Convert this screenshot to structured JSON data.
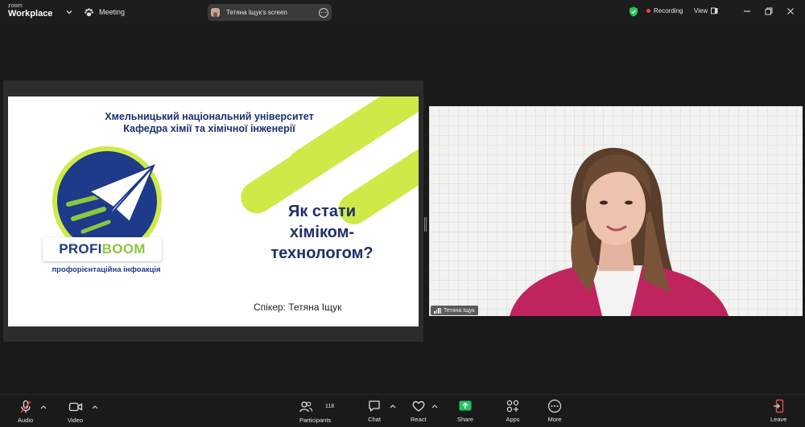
{
  "topbar": {
    "logo_line1": "zoom",
    "logo_line2": "Workplace",
    "meeting_label": "Meeting",
    "screen_title": "Тетяна Іщук's screen",
    "more_glyph": "⋯",
    "recording_label": "Recording",
    "view_label": "View"
  },
  "slide": {
    "university_line1": "Хмельницький національний університет",
    "university_line2": "Кафедра хімії та хімічної інженерії",
    "title_line1": "Як стати",
    "title_line2": "хіміком-",
    "title_line3": "технологом?",
    "speaker": "Спікер: Тетяна Іщук",
    "brand_part1": "PROFI",
    "brand_part2": "BOOM",
    "brand_sub": "профорієнтаційна інфоакція",
    "colors": {
      "navy": "#1e2f6b",
      "lime": "#cdea48",
      "green": "#8cc63f"
    }
  },
  "video": {
    "participant_name": "Тетяна Іщук"
  },
  "toolbar": {
    "audio_label": "Audio",
    "video_label": "Video",
    "participants_label": "Participants",
    "participants_count": "118",
    "chat_label": "Chat",
    "react_label": "React",
    "share_label": "Share",
    "apps_label": "Apps",
    "more_label": "More",
    "leave_label": "Leave",
    "share_color": "#22c55e",
    "leave_color": "#e5484d"
  }
}
